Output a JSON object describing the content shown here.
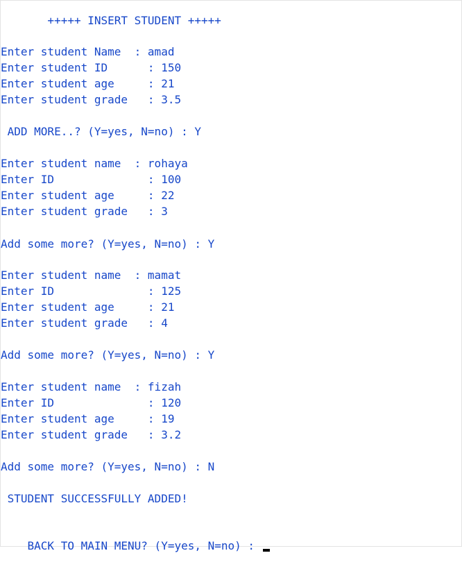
{
  "console": {
    "lines": [
      "       +++++ INSERT STUDENT +++++",
      "Enter student Name  : amad",
      "Enter student ID      : 150",
      "Enter student age     : 21",
      "Enter student grade   : 3.5",
      " ADD MORE..? (Y=yes, N=no) : Y",
      "Enter student name  : rohaya",
      "Enter ID              : 100",
      "Enter student age     : 22",
      "Enter student grade   : 3",
      "Add some more? (Y=yes, N=no) : Y",
      "Enter student name  : mamat",
      "Enter ID              : 125",
      "Enter student age     : 21",
      "Enter student grade   : 4",
      "Add some more? (Y=yes, N=no) : Y",
      "Enter student name  : fizah",
      "Enter ID              : 120",
      "Enter student age     : 19",
      "Enter student grade   : 3.2",
      "Add some more? (Y=yes, N=no) : N",
      " STUDENT SUCCESSFULLY ADDED!",
      "BACK TO MAIN MENU? (Y=yes, N=no) : "
    ]
  },
  "colors": {
    "text": "#1747c9",
    "background": "#ffffff",
    "cursor": "#000000"
  }
}
